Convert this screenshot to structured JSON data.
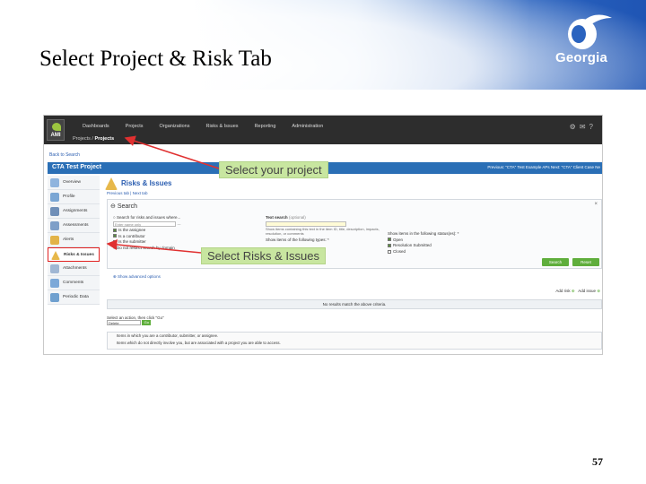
{
  "slide": {
    "title": "Select Project & Risk Tab",
    "logo_text": "Georgia",
    "page_number": "57"
  },
  "app": {
    "logo_label": "AMI",
    "nav": [
      "Dashboards",
      "Projects",
      "Organizations",
      "Risks & Issues",
      "Reporting",
      "Administration"
    ],
    "breadcrumb_parent": "Projects",
    "breadcrumb_current": "Projects",
    "back_link": "Back to Search",
    "project_name": "CTA Test Project",
    "project_bar_right": "Previous: \"CTA\"  Test Example APs  Next: \"CTA\"  Client Case Ne"
  },
  "sidebar": {
    "items": [
      {
        "label": "Overview",
        "color": "#8fb4de"
      },
      {
        "label": "Profile",
        "color": "#7aa6d4"
      },
      {
        "label": "Assignments",
        "color": "#6f8fb8"
      },
      {
        "label": "Assessments",
        "color": "#7e9fc8"
      },
      {
        "label": "Alerts",
        "color": "#e2b348"
      },
      {
        "label": "Risks & Issues",
        "color": "#e7b84a"
      },
      {
        "label": "Attachments",
        "color": "#a0b7d4"
      },
      {
        "label": "Comments",
        "color": "#7ca8d8"
      },
      {
        "label": "Periodic Data",
        "color": "#6fa0cf"
      }
    ],
    "selected_index": 5
  },
  "main": {
    "title": "Risks & Issues",
    "tabs": "Previous tab  |  Next tab",
    "search_label": "Search",
    "close_label": "×",
    "search_for": "Search for risks and issues where...",
    "search_field_value": "Enter name only",
    "assignee": "Is the assignee",
    "contributor": "Is a contributor",
    "submitter": "Is the submitter",
    "restrict": "Do not restrict search by domain",
    "text_search_label": "Text search",
    "text_search_hint": "(optional)",
    "text_search_desc": "Show items containing this text in the item ID, title, description, impacts, resolution, or comments",
    "types_label": "Show items of the following types: *",
    "statuses_label": "Show items in the following status(es): *",
    "status_options": [
      "Open",
      "Resolution Submitted",
      "Closed"
    ],
    "search_button": "Search",
    "reset_button": "Reset",
    "advanced_link": "Show advanced options",
    "add_risk": "Add risk",
    "add_issue": "Add issue",
    "no_results": "No results match the above criteria.",
    "action_prompt": "Select an action, then click \"Go\"",
    "action_value": "Delete",
    "go_button": "Go",
    "legend_1": "Items in which you are a contributor, submitter, or assignee.",
    "legend_2": "Items which do not directly involve you, but are associated with a project you are able to access."
  },
  "callouts": {
    "project": "Select your project",
    "risks": "Select Risks & Issues"
  }
}
